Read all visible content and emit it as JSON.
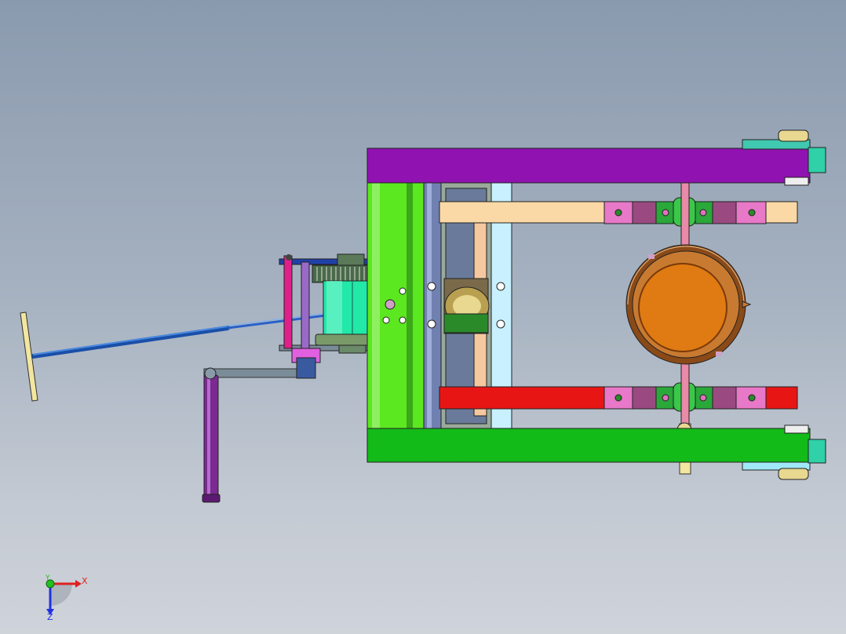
{
  "viewport": {
    "background_top": "#8a9aae",
    "background_bottom": "#cfd3da"
  },
  "triad": {
    "x_label": "X",
    "y_label": "Y",
    "z_label": "Z",
    "x_color": "#e02020",
    "y_color": "#20c020",
    "z_color": "#2030e0"
  },
  "parts": {
    "top_frame_color": "#9012b0",
    "bottom_frame_color": "#12bb18",
    "cream_bar_color": "#fbd9a6",
    "red_bar_color": "#e81515",
    "drum_color": "#20e8a8",
    "ring_color": "#e07a12",
    "handle_color": "#1a55c0",
    "crank_color": "#8a3a9a"
  }
}
